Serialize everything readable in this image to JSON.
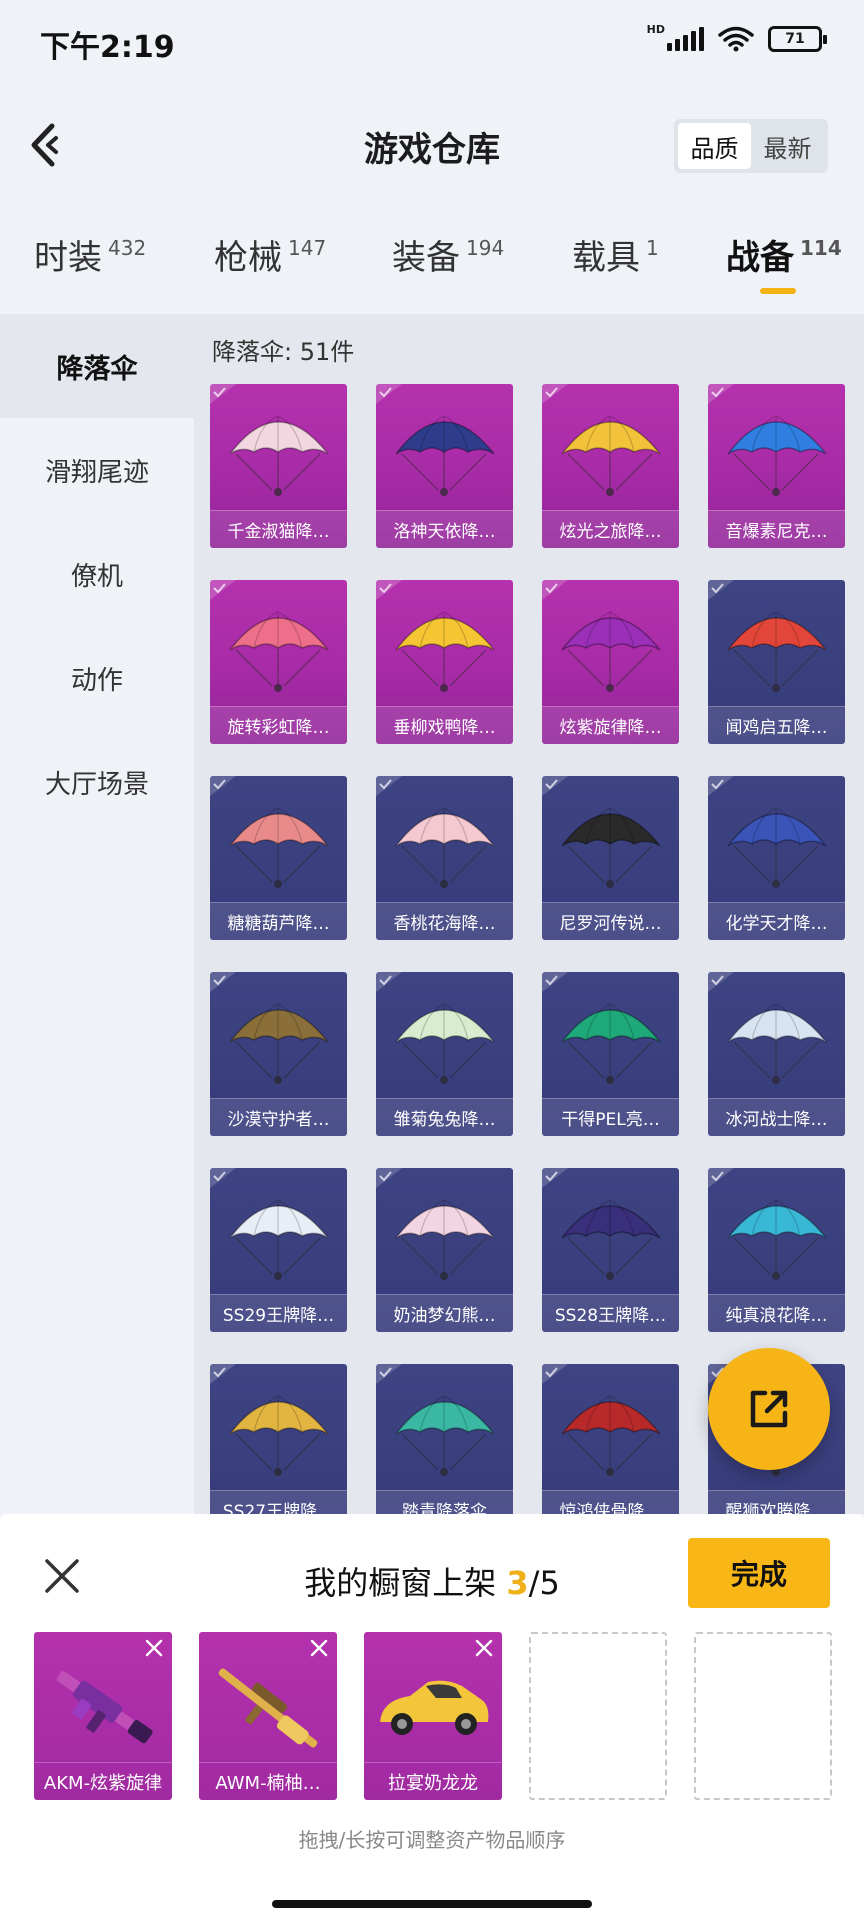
{
  "status_bar": {
    "time": "下午2:19",
    "network_label": "HD",
    "battery": "71"
  },
  "header": {
    "title": "游戏仓库",
    "sort_options": [
      {
        "label": "品质",
        "active": true
      },
      {
        "label": "最新",
        "active": false
      }
    ]
  },
  "category_tabs": [
    {
      "label": "时装",
      "count": "432",
      "active": false
    },
    {
      "label": "枪械",
      "count": "147",
      "active": false
    },
    {
      "label": "装备",
      "count": "194",
      "active": false
    },
    {
      "label": "载具",
      "count": "1",
      "active": false
    },
    {
      "label": "战备",
      "count": "114",
      "active": true
    }
  ],
  "sidebar": {
    "items": [
      {
        "label": "降落伞",
        "active": true
      },
      {
        "label": "滑翔尾迹",
        "active": false
      },
      {
        "label": "僚机",
        "active": false
      },
      {
        "label": "动作",
        "active": false
      },
      {
        "label": "大厅场景",
        "active": false
      }
    ]
  },
  "content": {
    "count_text": "降落伞: 51件",
    "items": [
      {
        "name": "千金淑猫降…",
        "rarity": "purple",
        "color": "#f2d6e0"
      },
      {
        "name": "洛神天依降…",
        "rarity": "purple",
        "color": "#2e3c8c"
      },
      {
        "name": "炫光之旅降…",
        "rarity": "purple",
        "color": "#f2c23a"
      },
      {
        "name": "音爆素尼克…",
        "rarity": "purple",
        "color": "#2f7ee0"
      },
      {
        "name": "旋转彩虹降…",
        "rarity": "purple",
        "color": "#ee6f8a"
      },
      {
        "name": "垂柳戏鸭降…",
        "rarity": "purple",
        "color": "#f6c534"
      },
      {
        "name": "炫紫旋律降…",
        "rarity": "purple",
        "color": "#9b2fb8"
      },
      {
        "name": "闻鸡启五降…",
        "rarity": "blue",
        "color": "#e2463a"
      },
      {
        "name": "糖糖葫芦降…",
        "rarity": "blue",
        "color": "#e88a8a"
      },
      {
        "name": "香桃花海降…",
        "rarity": "blue",
        "color": "#f5c9d2"
      },
      {
        "name": "尼罗河传说…",
        "rarity": "blue",
        "color": "#2a2a2a"
      },
      {
        "name": "化学天才降…",
        "rarity": "blue",
        "color": "#3b54b8"
      },
      {
        "name": "沙漠守护者…",
        "rarity": "blue",
        "color": "#8a6f3a"
      },
      {
        "name": "雏菊兔兔降…",
        "rarity": "blue",
        "color": "#d8eccf"
      },
      {
        "name": "干得PEL亮…",
        "rarity": "blue",
        "color": "#1fa87a"
      },
      {
        "name": "冰河战士降…",
        "rarity": "blue",
        "color": "#d9e4f2"
      },
      {
        "name": "SS29王牌降…",
        "rarity": "blue",
        "color": "#e8eef5"
      },
      {
        "name": "奶油梦幻熊…",
        "rarity": "blue",
        "color": "#f2d4e2"
      },
      {
        "name": "SS28王牌降…",
        "rarity": "blue",
        "color": "#3a2f7a"
      },
      {
        "name": "纯真浪花降…",
        "rarity": "blue",
        "color": "#39b8d6"
      },
      {
        "name": "SS27王牌降…",
        "rarity": "blue",
        "color": "#e2b542"
      },
      {
        "name": "踏青降落伞",
        "rarity": "blue",
        "color": "#3ab8a4"
      },
      {
        "name": "惊鸿侠骨降…",
        "rarity": "blue",
        "color": "#b82a2a"
      },
      {
        "name": "醒狮欢腾降…",
        "rarity": "blue",
        "color": "#e85a2a"
      }
    ]
  },
  "panel": {
    "title_prefix": "我的橱窗上架 ",
    "current": "3",
    "total": "/5",
    "done_label": "完成",
    "slots": [
      {
        "name": "AKM-炫紫旋律",
        "filled": true,
        "kind": "rifle"
      },
      {
        "name": "AWM-楠柚…",
        "filled": true,
        "kind": "sniper"
      },
      {
        "name": "拉宴奶龙龙",
        "filled": true,
        "kind": "car"
      },
      {
        "name": "",
        "filled": false
      },
      {
        "name": "",
        "filled": false
      }
    ],
    "hint": "拖拽/长按可调整资产物品顺序"
  },
  "colors": {
    "accent": "#f6b416",
    "purple_card": "#a72ba6",
    "blue_card": "#3a3f7d"
  }
}
